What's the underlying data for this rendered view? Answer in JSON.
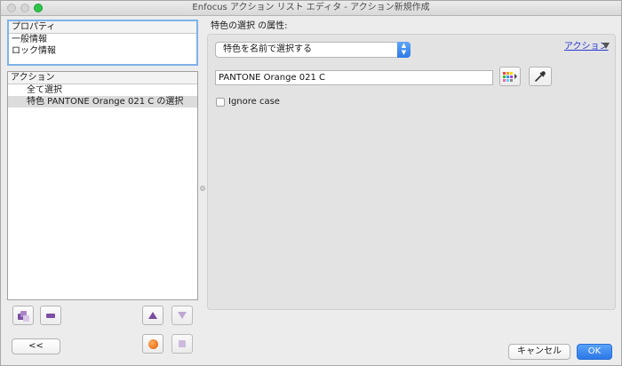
{
  "window": {
    "title": "Enfocus アクション リスト エディタ - アクション新規作成"
  },
  "properties_panel": {
    "header": "プロパティ",
    "items": [
      "一般情報",
      "ロック情報"
    ]
  },
  "actions_panel": {
    "header": "アクション",
    "items": [
      {
        "label": "全て選択",
        "selected": false
      },
      {
        "label": "特色 PANTONE Orange 021 C の選択",
        "selected": true
      }
    ]
  },
  "left_buttons": {
    "back_label": "<<",
    "icons": [
      "add-actions-icon",
      "remove-action-icon",
      "move-up-icon",
      "move-down-icon",
      "run-action-icon",
      "stop-action-icon"
    ]
  },
  "attributes": {
    "label": "特色の選択 の属性:",
    "action_menu_label": "アクション",
    "selection_method": "特色を名前で選択する",
    "color_name_value": "PANTONE Orange 021 C",
    "ignore_case_label": "Ignore case",
    "ignore_case_checked": false
  },
  "dialog_buttons": {
    "cancel_label": "キャンセル",
    "ok_label": "OK"
  },
  "colors": {
    "accent": "#2f7be8",
    "icon_purple": "#7b4fa3",
    "zoom_green": "#2dc44a"
  }
}
